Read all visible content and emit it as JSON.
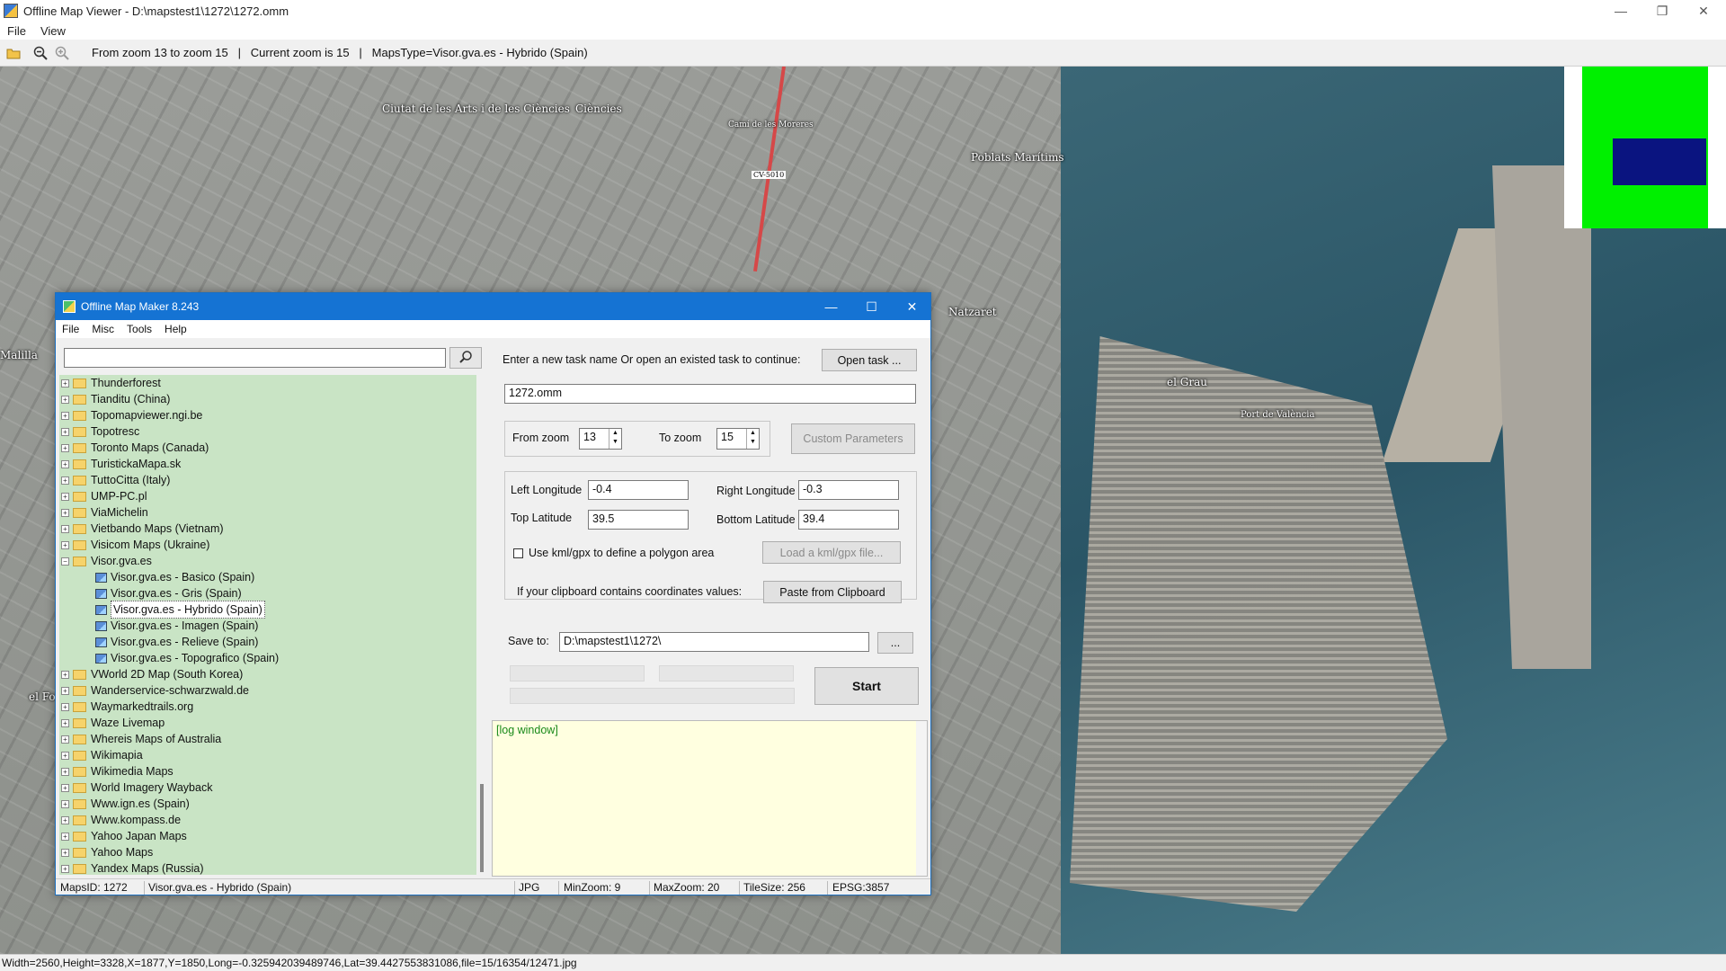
{
  "viewer": {
    "title": "Offline Map Viewer - D:\\mapstest1\\1272\\1272.omm",
    "menu": [
      "File",
      "View"
    ],
    "zoom_info": "From zoom 13 to zoom 15   |   Current zoom is 15   |   MapsType=Visor.gva.es - Hybrido (Spain)",
    "status": "Width=2560,Height=3328,X=1877,Y=1850,Long=-0.325942039489746,Lat=39.4427553831086,file=15/16354/12471.jpg",
    "icons": [
      "folder-open-icon",
      "zoom-out-icon",
      "zoom-in-icon"
    ],
    "window_controls": {
      "minimize": "—",
      "restore": "❐",
      "close": "✕"
    }
  },
  "map_labels": [
    "Ciutat de les Arts i de les Ciències",
    "Ciències",
    "Camí de les Moreres",
    "CV-5010",
    "Poblats Marítims",
    "Natzaret",
    "Malilla",
    "el Grau",
    "Port de València",
    "el Fo"
  ],
  "overview": {
    "viewport_color": "#0a1480",
    "area_color": "#00f000"
  },
  "dialog": {
    "title": "Offline Map Maker 8.243",
    "menu": [
      "File",
      "Misc",
      "Tools",
      "Help"
    ],
    "search_icon": "search-icon",
    "tree": [
      {
        "label": "Thunderforest",
        "type": "folder"
      },
      {
        "label": "Tianditu (China)",
        "type": "folder"
      },
      {
        "label": "Topomapviewer.ngi.be",
        "type": "folder"
      },
      {
        "label": "Topotresc",
        "type": "folder"
      },
      {
        "label": "Toronto Maps (Canada)",
        "type": "folder"
      },
      {
        "label": "TuristickaMapa.sk",
        "type": "folder"
      },
      {
        "label": "TuttoCitta (Italy)",
        "type": "folder"
      },
      {
        "label": "UMP-PC.pl",
        "type": "folder"
      },
      {
        "label": "ViaMichelin",
        "type": "folder"
      },
      {
        "label": "Vietbando Maps (Vietnam)",
        "type": "folder"
      },
      {
        "label": "Visicom Maps (Ukraine)",
        "type": "folder"
      },
      {
        "label": "Visor.gva.es",
        "type": "folder-open"
      },
      {
        "label": "Visor.gva.es - Basico (Spain)",
        "type": "map"
      },
      {
        "label": "Visor.gva.es - Gris (Spain)",
        "type": "map"
      },
      {
        "label": "Visor.gva.es - Hybrido (Spain)",
        "type": "map",
        "selected": true
      },
      {
        "label": "Visor.gva.es - Imagen (Spain)",
        "type": "map"
      },
      {
        "label": "Visor.gva.es - Relieve (Spain)",
        "type": "map"
      },
      {
        "label": "Visor.gva.es - Topografico (Spain)",
        "type": "map"
      },
      {
        "label": "VWorld 2D Map (South Korea)",
        "type": "folder"
      },
      {
        "label": "Wanderservice-schwarzwald.de",
        "type": "folder"
      },
      {
        "label": "Waymarkedtrails.org",
        "type": "folder"
      },
      {
        "label": "Waze Livemap",
        "type": "folder"
      },
      {
        "label": "Whereis Maps of Australia",
        "type": "folder"
      },
      {
        "label": "Wikimapia",
        "type": "folder"
      },
      {
        "label": "Wikimedia Maps",
        "type": "folder"
      },
      {
        "label": "World Imagery Wayback",
        "type": "folder"
      },
      {
        "label": "Www.ign.es (Spain)",
        "type": "folder"
      },
      {
        "label": "Www.kompass.de",
        "type": "folder"
      },
      {
        "label": "Yahoo Japan Maps",
        "type": "folder"
      },
      {
        "label": "Yahoo Maps",
        "type": "folder"
      },
      {
        "label": "Yandex Maps (Russia)",
        "type": "folder"
      }
    ],
    "task_prompt": "Enter a new task name Or open an existed task to continue:",
    "open_task_label": "Open task ...",
    "task_name": "1272.omm",
    "from_zoom_label": "From zoom",
    "from_zoom": "13",
    "to_zoom_label": "To zoom",
    "to_zoom": "15",
    "custom_params_label": "Custom Parameters",
    "left_lon_label": "Left Longitude",
    "left_lon": "-0.4",
    "right_lon_label": "Right Longitude",
    "right_lon": "-0.3",
    "top_lat_label": "Top Latitude",
    "top_lat": "39.5",
    "bottom_lat_label": "Bottom Latitude",
    "bottom_lat": "39.4",
    "kml_label": "Use kml/gpx to define a polygon area",
    "load_kml_label": "Load a kml/gpx file...",
    "clipboard_label": "If your clipboard contains coordinates values:",
    "paste_label": "Paste from Clipboard",
    "save_to_label": "Save to:",
    "save_to": "D:\\mapstest1\\1272\\",
    "browse_label": "...",
    "start_label": "Start",
    "log_text": "[log window]",
    "status": {
      "maps_id": "MapsID: 1272",
      "maps_name": "Visor.gva.es - Hybrido (Spain)",
      "format": "JPG",
      "min_zoom": "MinZoom: 9",
      "max_zoom": "MaxZoom: 20",
      "tile_size": "TileSize: 256",
      "epsg": "EPSG:3857"
    }
  }
}
